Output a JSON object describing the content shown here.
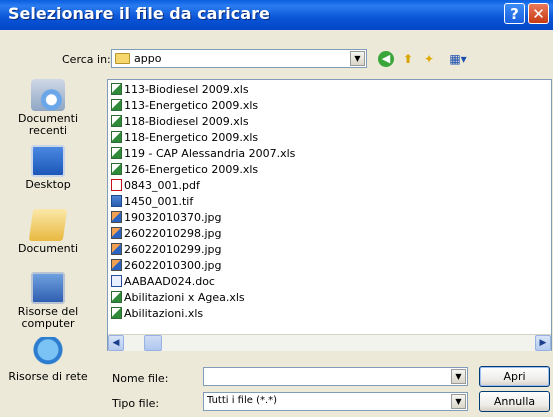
{
  "window": {
    "title": "Selezionare il file da caricare",
    "help_glyph": "?",
    "close_glyph": "✕"
  },
  "lookin": {
    "label": "Cerca in:",
    "value": "appo"
  },
  "toolbar": {
    "back_glyph": "◀",
    "up_glyph": "⬆",
    "new_folder_glyph": "✦",
    "views_glyph": "▦▾"
  },
  "places": [
    {
      "label": "Documenti recenti",
      "icon": "recent-documents-icon"
    },
    {
      "label": "Desktop",
      "icon": "desktop-icon"
    },
    {
      "label": "Documenti",
      "icon": "documents-icon"
    },
    {
      "label": "Risorse del computer",
      "icon": "my-computer-icon"
    },
    {
      "label": "Risorse di rete",
      "icon": "network-icon"
    }
  ],
  "files": [
    {
      "name": "113-Biodiesel 2009.xls",
      "type": "xls"
    },
    {
      "name": "113-Energetico 2009.xls",
      "type": "xls"
    },
    {
      "name": "118-Biodiesel 2009.xls",
      "type": "xls"
    },
    {
      "name": "118-Energetico 2009.xls",
      "type": "xls"
    },
    {
      "name": "119 - CAP Alessandria 2007.xls",
      "type": "xls"
    },
    {
      "name": "126-Energetico 2009.xls",
      "type": "xls"
    },
    {
      "name": "0843_001.pdf",
      "type": "pdf"
    },
    {
      "name": "1450_001.tif",
      "type": "tif"
    },
    {
      "name": "19032010370.jpg",
      "type": "jpg"
    },
    {
      "name": "26022010298.jpg",
      "type": "jpg"
    },
    {
      "name": "26022010299.jpg",
      "type": "jpg"
    },
    {
      "name": "26022010300.jpg",
      "type": "jpg"
    },
    {
      "name": "AABAAD024.doc",
      "type": "doc"
    },
    {
      "name": "Abilitazioni x Agea.xls",
      "type": "xls"
    },
    {
      "name": "Abilitazioni.xls",
      "type": "xls"
    }
  ],
  "form": {
    "filename_label": "Nome file:",
    "filename_value": "",
    "filetype_label": "Tipo file:",
    "filetype_value": "Tutti i file (*.*)"
  },
  "buttons": {
    "open": "Apri",
    "cancel": "Annulla"
  },
  "colors": {
    "titlebar": "#0a54d6",
    "dialog_bg": "#ece9d8",
    "list_border": "#7f9db9"
  }
}
